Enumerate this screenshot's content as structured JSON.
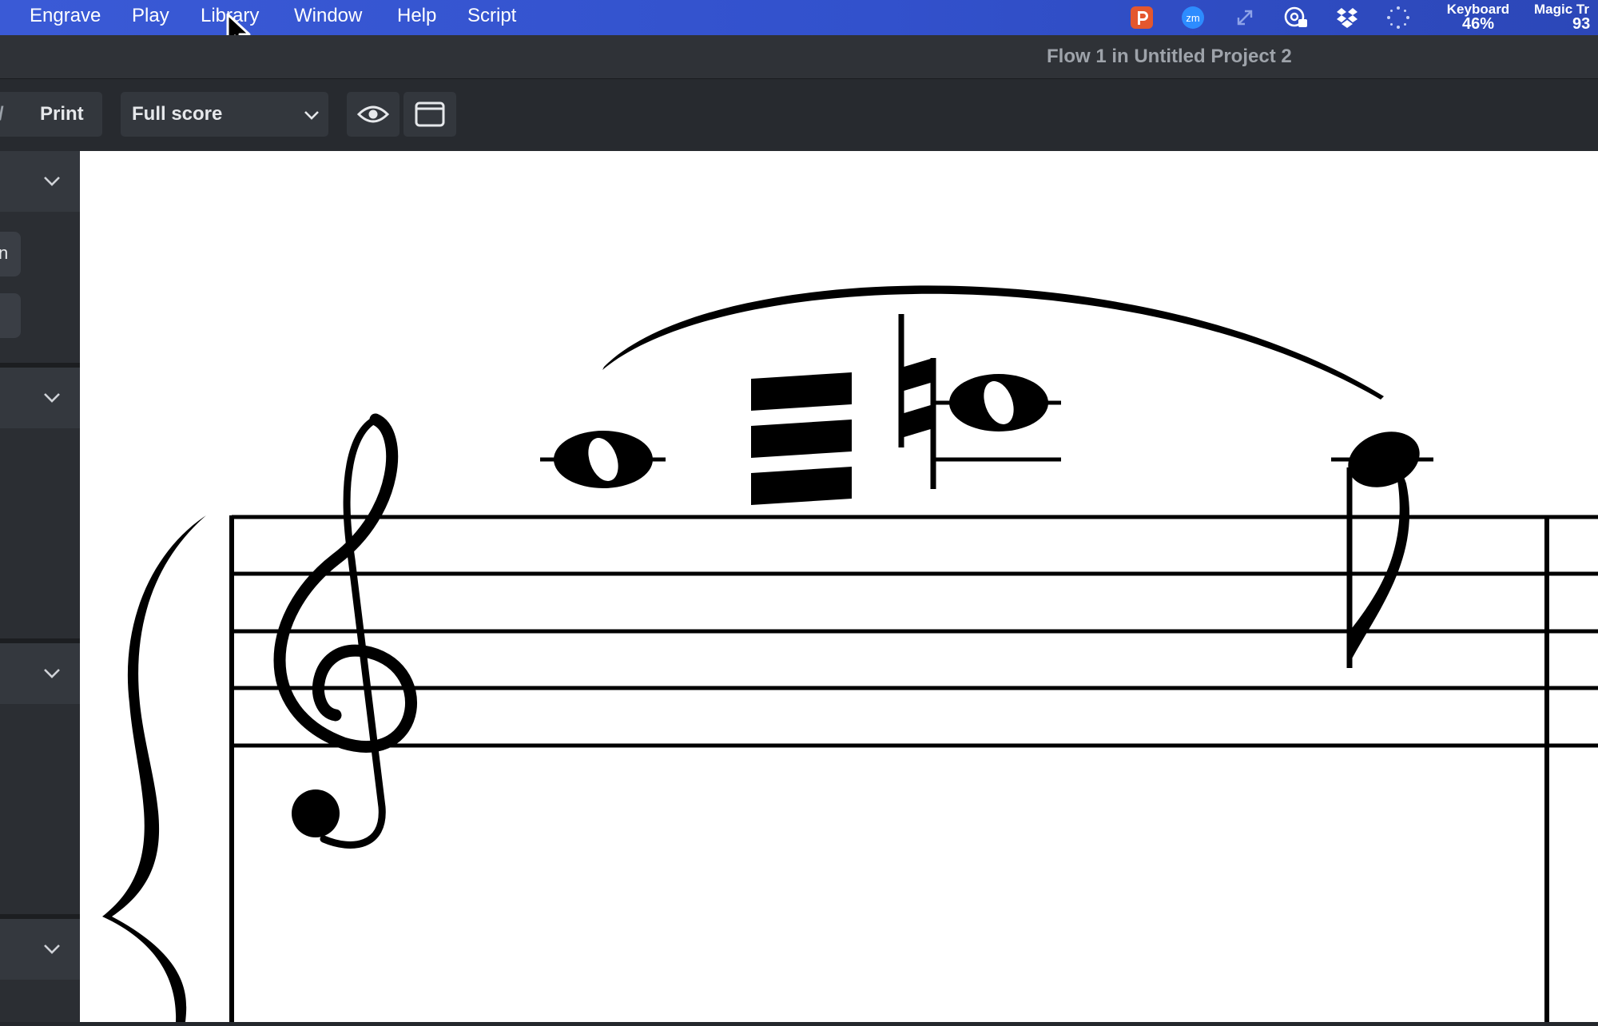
{
  "menubar": {
    "items": [
      "Engrave",
      "Play",
      "Library",
      "Window",
      "Help",
      "Script"
    ],
    "tray": {
      "keyboard_label": "Keyboard",
      "keyboard_value": "46%",
      "magic_label": "Magic Tr",
      "magic_value": "93"
    }
  },
  "window": {
    "title": "Flow 1 in Untitled Project 2"
  },
  "toolbar": {
    "print_label": "Print",
    "layout_select": "Full score"
  },
  "left_panel": {
    "chip_text": "n"
  },
  "colors": {
    "menubar": "#3251cc",
    "toolbar": "#272a2f",
    "panel": "#2b2e33",
    "page": "#ffffff",
    "notation": "#000000"
  }
}
